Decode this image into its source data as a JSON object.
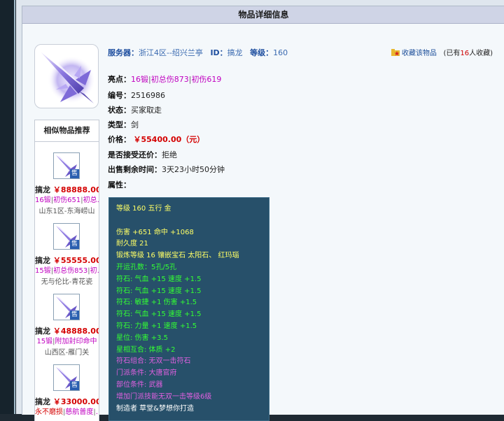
{
  "header": {
    "title": "物品详细信息"
  },
  "item": {
    "server_label": "服务器：",
    "server": "浙江4区--绍兴兰亭",
    "id_label": "ID：",
    "id": "搞龙",
    "level_label": "等级：",
    "level": "160",
    "favorite_label": "收藏该物品",
    "fav_prefix": "(已有",
    "fav_count": "16",
    "fav_suffix": "人收藏)",
    "highlight_label": "亮点：",
    "highlights": [
      "16锻",
      "初总伤873",
      "初伤619"
    ],
    "number_label": "编号：",
    "number": "2516986",
    "status_label": "状态：",
    "status": "买家取走",
    "type_label": "类型：",
    "type": "剑",
    "price_label": "价格：",
    "price": "￥55400.00（元）",
    "bargain_label": "是否接受还价：",
    "bargain": "拒绝",
    "time_label": "出售剩余时间：",
    "time": "3天23小时50分钟",
    "attr_label": "属性："
  },
  "attributes": [
    {
      "text": "等级 160 五行 金",
      "color": "y"
    },
    {
      "text": "",
      "color": "y"
    },
    {
      "text": "伤害 +651 命中 +1068",
      "color": "y"
    },
    {
      "text": "耐久度 21",
      "color": "y"
    },
    {
      "text": "锻炼等级 16 镶嵌宝石 太阳石、 红玛瑙",
      "color": "y"
    },
    {
      "text": "开运孔数：5孔/5孔",
      "color": "g"
    },
    {
      "text": "符石: 气血 +15 速度 +1.5",
      "color": "g"
    },
    {
      "text": "符石: 气血 +15 速度 +1.5",
      "color": "g"
    },
    {
      "text": "符石: 敏捷 +1 伤害 +1.5",
      "color": "g"
    },
    {
      "text": "符石: 气血 +15 速度 +1.5",
      "color": "g"
    },
    {
      "text": "符石: 力量 +1 速度 +1.5",
      "color": "g"
    },
    {
      "text": "星位: 伤害 +3.5",
      "color": "g"
    },
    {
      "text": "星相互合: 体质 +2",
      "color": "g"
    },
    {
      "text": "符石组合: 无双一击符石",
      "color": "p"
    },
    {
      "text": "门派条件: 大唐官府",
      "color": "p"
    },
    {
      "text": "部位条件: 武器",
      "color": "p"
    },
    {
      "text": "增加门派技能无双一击等级6级",
      "color": "p"
    },
    {
      "text": "制造者 草堂&梦想你打造",
      "color": "w"
    }
  ],
  "sidebar": {
    "title": "相似物品推荐",
    "items": [
      {
        "name": "搞龙",
        "price": "￥88888.00",
        "tags": [
          "16锻",
          "初伤651",
          "初总…"
        ],
        "server": "山东1区-东海崂山"
      },
      {
        "name": "搞龙",
        "price": "￥55555.00",
        "tags": [
          "15锻",
          "初总伤853",
          "初…"
        ],
        "server": "无与伦比-青花瓷"
      },
      {
        "name": "搞龙",
        "price": "￥48888.00",
        "tags": [
          "15锻",
          "附加封印命中"
        ],
        "server": "山西区-雁门关"
      },
      {
        "name": "搞龙",
        "price": "￥33000.00",
        "tags": [
          "永不磨损",
          "慈航普度",
          "…"
        ],
        "server": ""
      }
    ],
    "badge": "售"
  },
  "colors": {
    "accent_blue": "#2050a0",
    "price_red": "#d40000",
    "highlight_magenta": "#c000c0",
    "attr_bg": "#27506a"
  }
}
